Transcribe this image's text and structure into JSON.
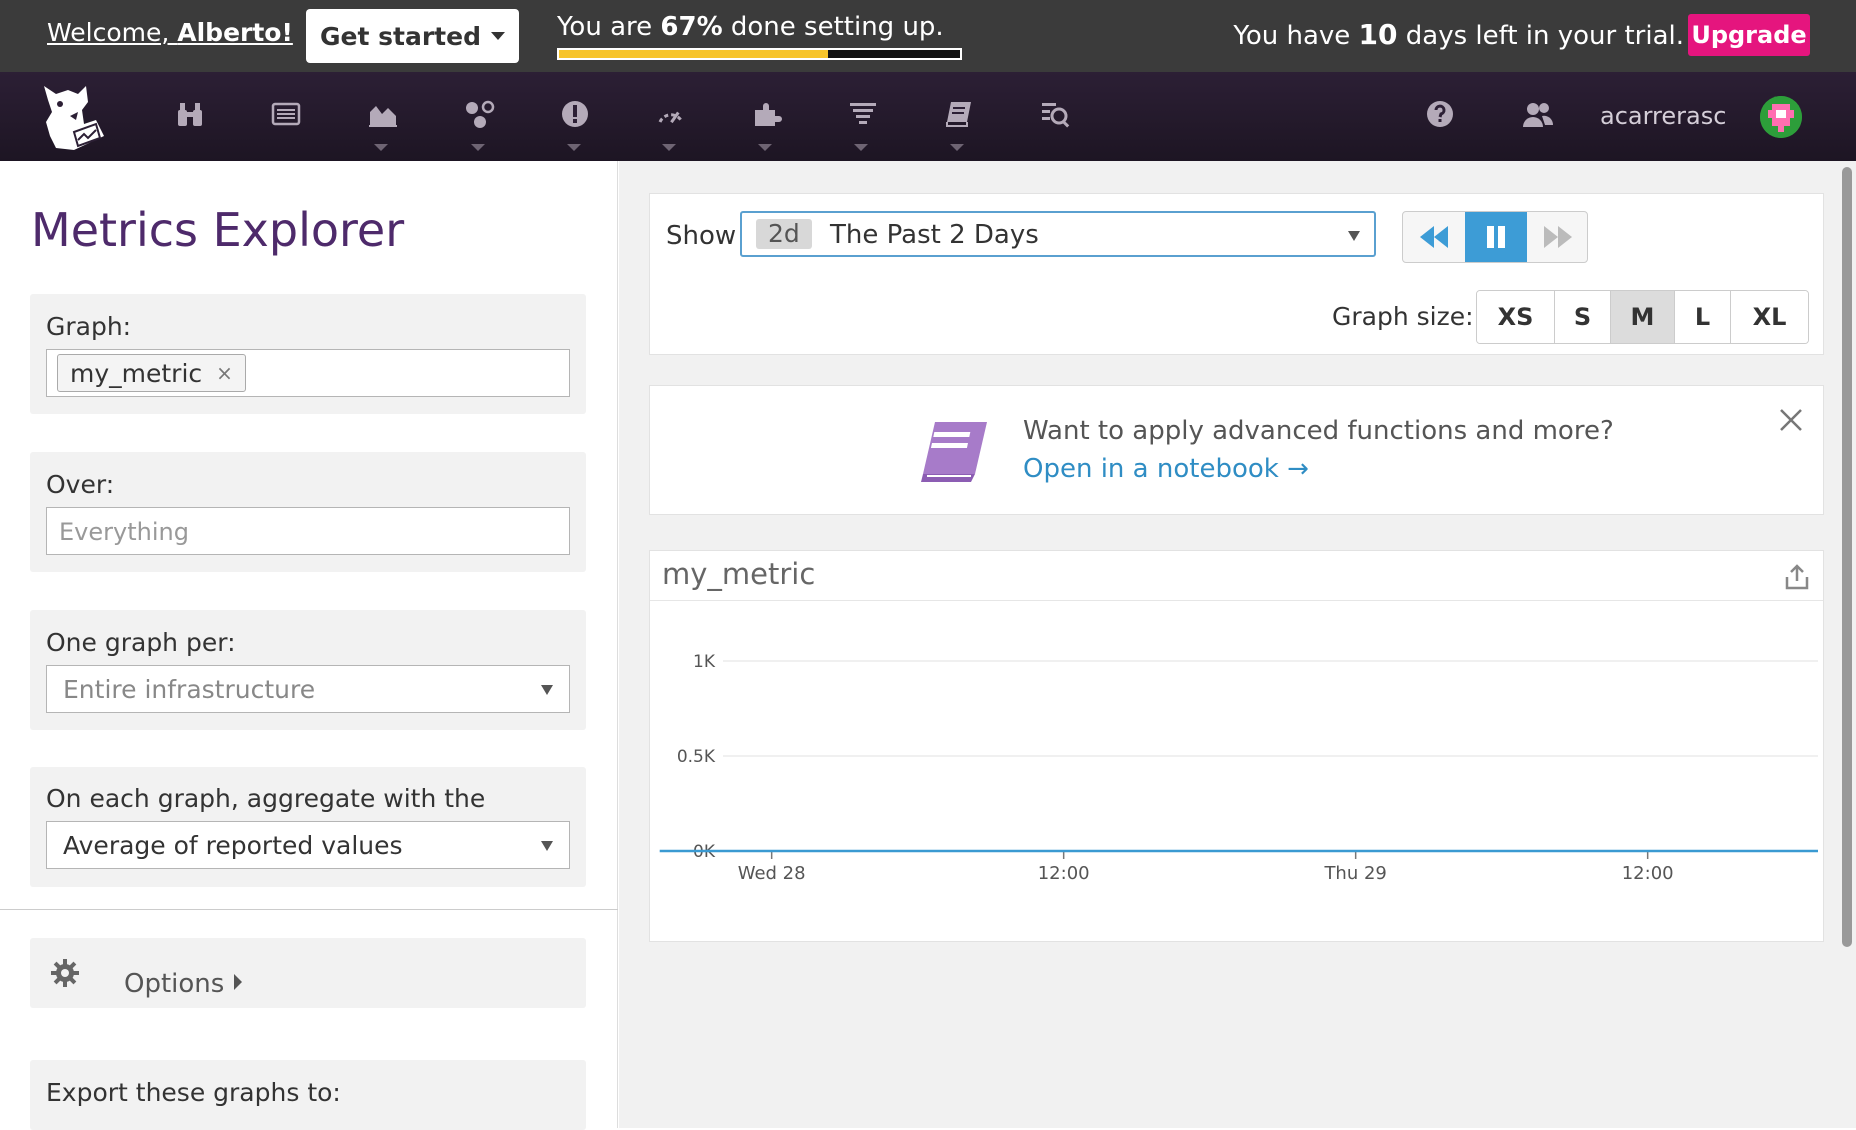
{
  "trial_bar": {
    "welcome_prefix": "Welcome, ",
    "welcome_name": "Alberto!",
    "get_started_label": "Get started",
    "setup_prefix": "You are ",
    "setup_percent_text": "67%",
    "setup_suffix": " done setting up.",
    "setup_progress_fraction": 0.67,
    "trial_prefix": "You have ",
    "trial_days": "10",
    "trial_suffix": " days left in your trial.",
    "upgrade_label": "Upgrade",
    "upgrade_color": "#e5157e",
    "progress_color": "#f7c42a"
  },
  "nav": {
    "icons": [
      "binoculars-icon",
      "list-icon",
      "dashboard-chart-icon",
      "infrastructure-icon",
      "monitors-icon",
      "apm-icon",
      "integrations-icon",
      "logs-icon",
      "notebooks-icon",
      "synthetics-icon"
    ],
    "help_icon": "help-icon",
    "team_icon": "team-icon",
    "username": "acarrerasc"
  },
  "left": {
    "title": "Metrics Explorer",
    "graph_label": "Graph:",
    "graph_tag": "my_metric",
    "over_label": "Over:",
    "over_placeholder": "Everything",
    "per_label": "One graph per:",
    "per_value": "Entire infrastructure",
    "aggregate_label": "On each graph, aggregate with the",
    "aggregate_value": "Average of reported values",
    "options_label": "Options",
    "export_label": "Export these graphs to:"
  },
  "timebar": {
    "show_label": "Show",
    "badge": "2d",
    "range_text": "The Past 2 Days",
    "graph_size_label": "Graph size:",
    "sizes": [
      "XS",
      "S",
      "M",
      "L",
      "XL"
    ],
    "active_size": "M",
    "accent_color": "#3d9cd6"
  },
  "promo": {
    "text": "Want to apply advanced functions and more?",
    "link": "Open in a notebook →"
  },
  "graph": {
    "title": "my_metric"
  },
  "chart_data": {
    "type": "line",
    "title": "my_metric",
    "xlabel": "",
    "ylabel": "",
    "ylim": [
      0,
      1000
    ],
    "y_ticks": [
      0,
      500,
      1000
    ],
    "y_tick_labels": [
      "0K",
      "0.5K",
      "1K"
    ],
    "x_range_hours": [
      -2.0,
      43.0
    ],
    "x_ticks_hours": [
      0,
      12,
      24,
      36
    ],
    "x_tick_labels": [
      "Wed 28",
      "12:00",
      "Thu 29",
      "12:00"
    ],
    "grid": true,
    "legend": "none",
    "line_color": "#3a9ad2",
    "series": [
      {
        "x": [
          -4.6,
          -4.5,
          -4.4,
          -4.3,
          -4.2,
          -4.0,
          -2.8,
          -2.6,
          -2.3,
          -2.1,
          -1.8,
          -1.5,
          -1.2,
          -1.0,
          -0.6,
          -0.2,
          0.3,
          1.0,
          1.5,
          2.0,
          2.6,
          3.2,
          3.8,
          4.4,
          5.0,
          5.5,
          6.0,
          6.5,
          7.0,
          7.5,
          8.0,
          8.5,
          9.0,
          9.6,
          10.1,
          10.7,
          11.2,
          11.8,
          12.2,
          12.7,
          13.1,
          13.5,
          13.9,
          14.3,
          14.7,
          15.1,
          15.4,
          15.8,
          16.1,
          16.5,
          16.9,
          17.3,
          17.8,
          18.3,
          18.8,
          19.3,
          19.8,
          20.3,
          20.8,
          21.2,
          21.6,
          21.9,
          22.2,
          22.6,
          23.0,
          23.4,
          23.8,
          24.2,
          24.6,
          25.0,
          25.4,
          25.8,
          26.2,
          26.6,
          27.0,
          27.4,
          27.8,
          28.2,
          28.6,
          29.0,
          29.4,
          29.8,
          30.2,
          30.6,
          31.0,
          31.4,
          31.8,
          32.2,
          32.6,
          33.0,
          33.4,
          33.8,
          34.2,
          34.6,
          35.0,
          35.4,
          35.8,
          36.2,
          36.6,
          37.0,
          37.4,
          37.8,
          38.2,
          38.6,
          39.0,
          39.4,
          39.8,
          40.2,
          40.6,
          41.0,
          41.4,
          41.8,
          42.2,
          42.6,
          43.0
        ],
        "y": [
          0,
          0,
          0,
          0,
          0,
          0,
          0,
          0,
          0,
          0,
          0,
          0,
          0,
          0,
          0,
          0,
          0,
          0,
          0,
          0,
          0,
          0,
          0,
          0,
          0,
          0,
          0,
          0,
          0,
          0,
          0,
          0,
          0,
          0,
          0,
          0,
          0,
          0,
          0,
          0,
          0,
          0,
          0,
          0,
          0,
          0,
          0,
          0,
          0,
          0,
          0,
          0,
          0,
          0,
          0,
          0,
          0,
          0,
          0,
          0,
          0,
          0,
          0,
          0,
          0,
          0,
          0,
          0,
          0,
          0,
          0,
          0,
          0,
          0,
          0,
          0,
          0,
          0,
          0,
          0,
          0,
          0,
          0,
          0,
          0,
          0,
          0,
          0,
          0,
          0,
          0,
          0,
          0,
          0,
          0,
          0,
          0,
          0,
          0,
          0,
          0,
          0,
          0,
          0,
          0,
          0,
          0,
          0,
          0,
          0,
          0,
          0,
          0,
          0,
          0
        ]
      }
    ]
  }
}
